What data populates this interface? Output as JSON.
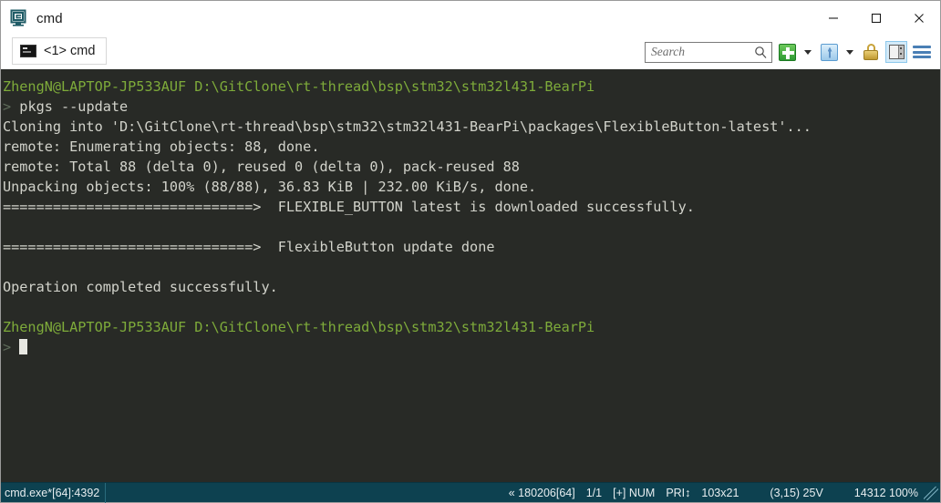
{
  "window": {
    "title": "cmd",
    "icon": "console-app-icon",
    "controls": {
      "minimize": "minimize-button",
      "maximize": "maximize-button",
      "close": "close-button"
    }
  },
  "tabs": [
    {
      "label": "<1> cmd",
      "icon": "console-tab-icon",
      "active": true
    }
  ],
  "toolbar": {
    "search": {
      "placeholder": "Search",
      "value": ""
    },
    "buttons": [
      {
        "name": "new-console-button",
        "icon": "green-plus-icon"
      },
      {
        "name": "new-console-dropdown",
        "icon": "chevron-down-icon"
      },
      {
        "name": "active-console-button",
        "icon": "blue-up-arrow-icon"
      },
      {
        "name": "active-console-dropdown",
        "icon": "chevron-down-icon"
      },
      {
        "name": "lock-button",
        "icon": "gold-padlock-icon"
      },
      {
        "name": "toggle-panel-button",
        "icon": "panel-split-icon"
      },
      {
        "name": "main-menu-button",
        "icon": "hamburger-menu-icon"
      }
    ]
  },
  "terminal": {
    "colors": {
      "background": "#282a26",
      "prompt_green": "#7eab3a",
      "text": "#cfd0c8",
      "prompt_symbol": "#5e6b5a",
      "cursor": "#e8e8e2"
    },
    "lines": [
      {
        "segments": [
          {
            "text": "ZhengN@LAPTOP-JP533AUF D:\\GitClone\\rt-thread\\bsp\\stm32\\stm32l431-BearPi",
            "style": "c-green"
          }
        ]
      },
      {
        "segments": [
          {
            "text": "> ",
            "style": "c-prompt"
          },
          {
            "text": "pkgs --update",
            "style": "c-white"
          }
        ]
      },
      {
        "segments": [
          {
            "text": "Cloning into 'D:\\GitClone\\rt-thread\\bsp\\stm32\\stm32l431-BearPi\\packages\\FlexibleButton-latest'...",
            "style": "c-white"
          }
        ]
      },
      {
        "segments": [
          {
            "text": "remote: Enumerating objects: 88, done.",
            "style": "c-white"
          }
        ]
      },
      {
        "segments": [
          {
            "text": "remote: Total 88 (delta 0), reused 0 (delta 0), pack-reused 88",
            "style": "c-white"
          }
        ]
      },
      {
        "segments": [
          {
            "text": "Unpacking objects: 100% (88/88), 36.83 KiB | 232.00 KiB/s, done.",
            "style": "c-white"
          }
        ]
      },
      {
        "segments": [
          {
            "text": "==============================>  FLEXIBLE_BUTTON latest is downloaded successfully.",
            "style": "c-white"
          }
        ]
      },
      {
        "segments": [
          {
            "text": "",
            "style": "c-white"
          }
        ]
      },
      {
        "segments": [
          {
            "text": "==============================>  FlexibleButton update done",
            "style": "c-white"
          }
        ]
      },
      {
        "segments": [
          {
            "text": "",
            "style": "c-white"
          }
        ]
      },
      {
        "segments": [
          {
            "text": "Operation completed successfully.",
            "style": "c-white"
          }
        ]
      },
      {
        "segments": [
          {
            "text": "",
            "style": "c-white"
          }
        ]
      },
      {
        "segments": [
          {
            "text": "ZhengN@LAPTOP-JP533AUF D:\\GitClone\\rt-thread\\bsp\\stm32\\stm32l431-BearPi",
            "style": "c-green"
          }
        ]
      },
      {
        "segments": [
          {
            "text": "> ",
            "style": "c-prompt"
          }
        ],
        "cursor": true
      }
    ]
  },
  "statusbar": {
    "process": "cmd.exe*[64]:4392",
    "build": "« 180206[64]",
    "tab_count": "1/1",
    "keys": "[+] NUM",
    "priority": "PRI↕",
    "size": "103x21",
    "cursor_pos": "(3,15) 25V",
    "memory": "14312 100%"
  }
}
